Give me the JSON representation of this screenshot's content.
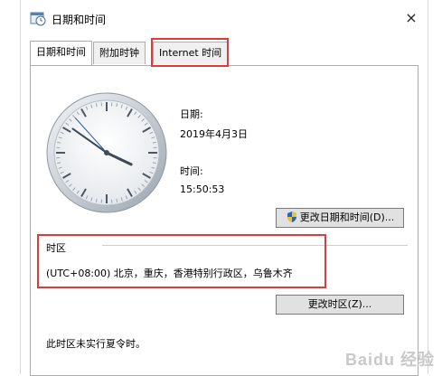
{
  "window": {
    "title": "日期和时间",
    "close_label": "×"
  },
  "tabs": [
    {
      "label": "日期和时间"
    },
    {
      "label": "附加时钟"
    },
    {
      "label": "Internet 时间"
    }
  ],
  "datetime": {
    "date_label": "日期:",
    "date_value": "2019年4月3日",
    "time_label": "时间:",
    "time_value": "15:50:53",
    "change_button": "更改日期和时间(D)..."
  },
  "timezone": {
    "section_label": "时区",
    "value": "(UTC+08:00) 北京，重庆，香港特别行政区，乌鲁木齐",
    "change_button": "更改时区(Z)..."
  },
  "dst_note": "此时区未实行夏令时。",
  "watermark": "Baidu 经验",
  "clock": {
    "hour": 15,
    "minute": 50,
    "second": 53
  },
  "colors": {
    "highlight": "#e53935",
    "shield_blue": "#1e66c9",
    "shield_yellow": "#f2c230"
  }
}
